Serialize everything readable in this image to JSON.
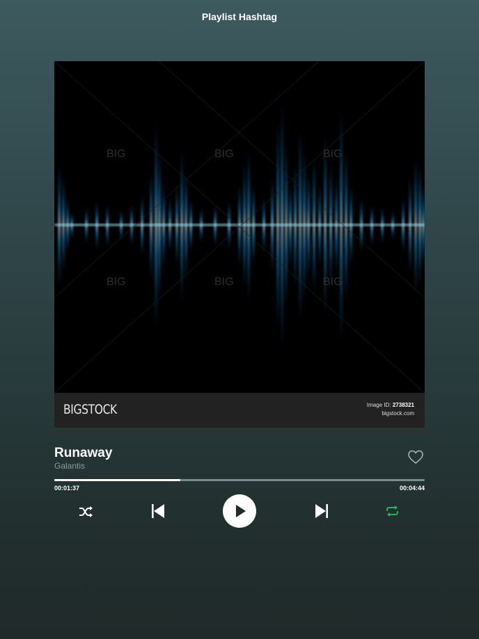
{
  "header": {
    "title": "Playlist Hashtag"
  },
  "artwork": {
    "watermark_logo": "BIGSTOCK",
    "image_id_label": "Image ID:",
    "image_id_value": "2738321",
    "site": "bigstock.com"
  },
  "track": {
    "title": "Runaway",
    "artist": "Galantis",
    "liked": false
  },
  "progress": {
    "elapsed": "00:01:37",
    "duration": "00:04:44",
    "fraction": 0.34
  },
  "controls": {
    "shuffle_icon": "shuffle-icon",
    "previous_icon": "skip-previous-icon",
    "play_icon": "play-icon",
    "next_icon": "skip-next-icon",
    "repeat_icon": "repeat-icon",
    "repeat_active": true
  },
  "colors": {
    "accent": "#1db954",
    "waveform": "#3fc4ff",
    "background_top": "#3d5a5e",
    "background_bottom": "#1f2a29"
  }
}
